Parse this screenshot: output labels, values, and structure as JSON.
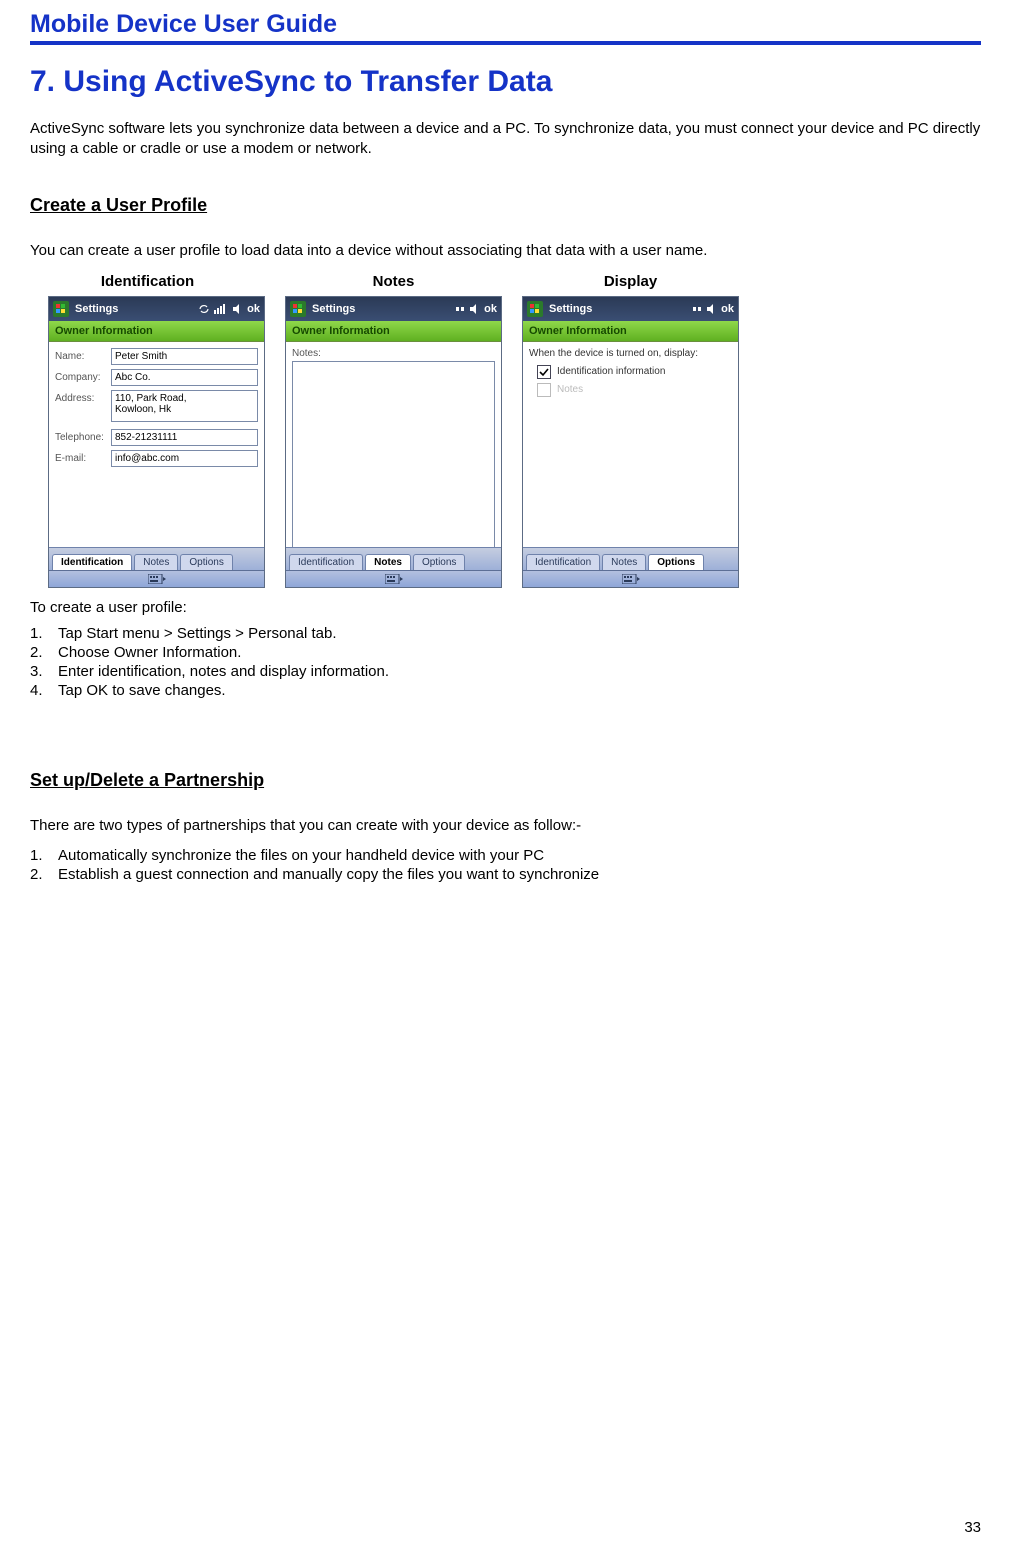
{
  "doc_title": "Mobile Device User Guide",
  "chapter_title": "7.  Using ActiveSync to Transfer Data",
  "intro": "ActiveSync software lets you synchronize data between a device and a PC. To synchronize data, you must connect your device and PC directly using a cable or cradle or use a modem or network.",
  "section1": {
    "heading": "Create a User Profile",
    "lead": "You can create a user profile to load data into a device without associating that data with a user name.",
    "after_label": "To create a user profile:",
    "steps": [
      "Tap Start menu > Settings > Personal tab.",
      "Choose Owner Information.",
      "Enter identification, notes and display information.",
      "Tap OK to save changes."
    ]
  },
  "section2": {
    "heading": "Set up/Delete a Partnership",
    "lead": "There are two types of partnerships that you can create with your device as follow:-",
    "steps": [
      "Automatically synchronize the files on your handheld device with your PC",
      "Establish a guest connection and manually copy the files you want to synchronize"
    ]
  },
  "screens": {
    "titlebar_app": "Settings",
    "titlebar_ok": "ok",
    "greenbar": "Owner Information",
    "tabs": {
      "identification": "Identification",
      "notes": "Notes",
      "options": "Options"
    },
    "identification": {
      "label": "Identification",
      "fields": {
        "name_label": "Name:",
        "name_value": "Peter Smith",
        "company_label": "Company:",
        "company_value": "Abc Co.",
        "address_label": "Address:",
        "address_value": "110, Park Road,\nKowloon, Hk",
        "telephone_label": "Telephone:",
        "telephone_value": "852-21231111",
        "email_label": "E-mail:",
        "email_value": "info@abc.com"
      }
    },
    "notes": {
      "label": "Notes",
      "field_label": "Notes:"
    },
    "display": {
      "label": "Display",
      "instruction": "When the device is turned on, display:",
      "opt_identification": "Identification information",
      "opt_notes": "Notes"
    }
  },
  "page_number": "33"
}
